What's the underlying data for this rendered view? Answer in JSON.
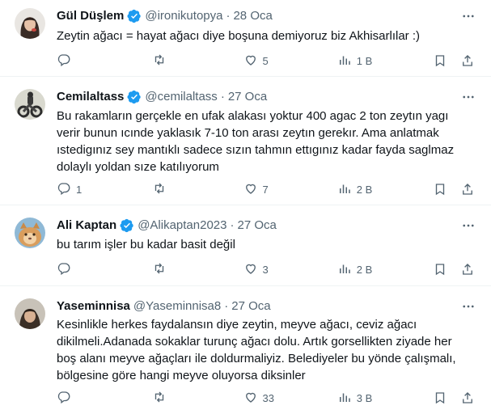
{
  "tweets": [
    {
      "name": "Gül Düşlem",
      "handle": "@ironikutopya",
      "sep": "·",
      "date": "28 Oca",
      "verified": true,
      "text": "Zeytin ağacı = hayat ağacı diye boşuna demiyoruz biz Akhisarlılar :)",
      "replies": "",
      "retweets": "",
      "likes": "5",
      "views": "1 B"
    },
    {
      "name": "Cemilaltass",
      "handle": "@cemilaltass",
      "sep": "·",
      "date": "27 Oca",
      "verified": true,
      "text": "Bu rakamların gerçekle en ufak alakası yoktur 400 agac 2 ton zeytın yagı verir bunun ıcınde yaklasık 7-10 ton arası zeytın gerekır. Ama anlatmak ıstedigınız sey mantıklı sadece sızın tahmın ettıgınız kadar fayda saglmaz dolaylı yoldan sıze katılıyorum",
      "replies": "1",
      "retweets": "",
      "likes": "7",
      "views": "2 B"
    },
    {
      "name": "Ali Kaptan",
      "handle": "@Alikaptan2023",
      "sep": "·",
      "date": "27 Oca",
      "verified": true,
      "text": "bu tarım işler bu kadar basit değil",
      "replies": "",
      "retweets": "",
      "likes": "3",
      "views": "2 B"
    },
    {
      "name": "Yaseminnisa",
      "handle": "@Yaseminnisa8",
      "sep": "·",
      "date": "27 Oca",
      "verified": false,
      "text": "Kesinlikle herkes faydalansın diye  zeytin, meyve ağacı, ceviz ağacı dikilmeli.Adanada  sokaklar  turunç  ağacı dolu. Artık  gorsellikten  ziyade her boş  alanı meyve  ağaçları  ile doldurmaliyiz. Belediyeler bu yönde çalışmalı, bölgesine göre hangi  meyve oluyorsa  diksinler",
      "replies": "",
      "retweets": "",
      "likes": "33",
      "views": "3 B"
    }
  ],
  "colors": {
    "text": "#0f1419",
    "muted": "#536471",
    "verified": "#1d9bf0",
    "divider": "#eff3f4"
  },
  "icons": [
    "more-icon",
    "reply-icon",
    "retweet-icon",
    "like-icon",
    "views-icon",
    "bookmark-icon",
    "share-icon",
    "verified-icon"
  ]
}
